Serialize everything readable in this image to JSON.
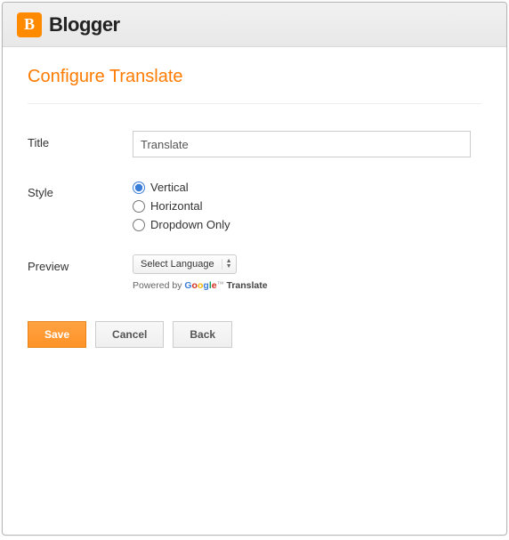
{
  "header": {
    "brand": "Blogger"
  },
  "page": {
    "title": "Configure Translate"
  },
  "form": {
    "title_label": "Title",
    "title_value": "Translate",
    "style_label": "Style",
    "style_options": {
      "vertical": "Vertical",
      "horizontal": "Horizontal",
      "dropdown": "Dropdown Only"
    },
    "style_selected": "vertical",
    "preview_label": "Preview",
    "preview_select_value": "Select Language",
    "powered_prefix": "Powered by ",
    "powered_translate": "Translate"
  },
  "buttons": {
    "save": "Save",
    "cancel": "Cancel",
    "back": "Back"
  }
}
